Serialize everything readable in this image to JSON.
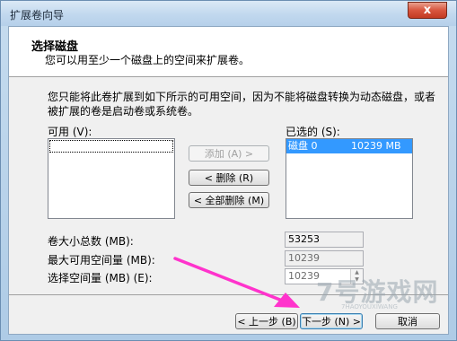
{
  "window": {
    "title": "扩展卷向导",
    "close_icon": "close-icon",
    "close_glyph": "x"
  },
  "header": {
    "title": "选择磁盘",
    "subtitle": "您可以用至少一个磁盘上的空间来扩展卷。"
  },
  "description": "您只能将此卷扩展到如下所示的可用空间，因为不能将磁盘转换为动态磁盘，或者被扩展的卷是启动卷或系统卷。",
  "available": {
    "label": "可用 (V):",
    "items": []
  },
  "selected": {
    "label": "已选的 (S):",
    "items": [
      {
        "disk": "磁盘 0",
        "size": "10239 MB"
      }
    ]
  },
  "buttons": {
    "add": "添加 (A) >",
    "remove": "< 删除 (R)",
    "remove_all": "< 全部删除 (M)",
    "back": "< 上一步 (B)",
    "next": "下一步 (N) >",
    "cancel": "取消"
  },
  "sizes": {
    "total_label": "卷大小总数 (MB):",
    "total_value": "53253",
    "max_label": "最大可用空间量 (MB):",
    "max_value": "10239",
    "select_label": "选择空间量 (MB) (E):",
    "select_value": "10239"
  },
  "annotation": {
    "arrow_color": "#ff33cc"
  },
  "watermark": {
    "text": "7号游戏网",
    "sub": "7HAOYOUXIWANG"
  }
}
